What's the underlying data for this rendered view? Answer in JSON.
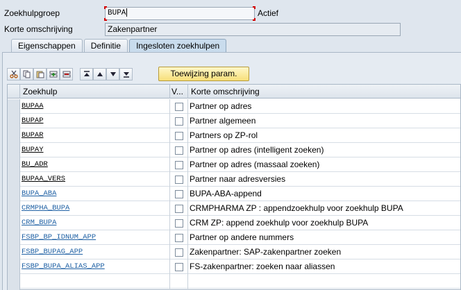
{
  "header": {
    "group_label": "Zoekhulpgroep",
    "group_value": "BUPA",
    "status": "Actief",
    "desc_label": "Korte omschrijving",
    "desc_value": "Zakenpartner"
  },
  "tabs": [
    {
      "label": "Eigenschappen",
      "active": false
    },
    {
      "label": "Definitie",
      "active": false
    },
    {
      "label": "Ingesloten zoekhulpen",
      "active": true
    }
  ],
  "toolbar": {
    "icons": [
      "cut-icon",
      "copy-icon",
      "paste-icon",
      "insert-row-icon",
      "delete-row-icon",
      "move-top-icon",
      "move-up-icon",
      "move-down-icon",
      "move-bottom-icon"
    ],
    "assign_label": "Toewijzing param."
  },
  "table": {
    "columns": [
      "Zoekhulp",
      "V...",
      "Korte omschrijving"
    ],
    "rows": [
      {
        "name": "BUPAA",
        "desc": "Partner op adres",
        "style": "dark",
        "checked": false
      },
      {
        "name": "BUPAP",
        "desc": "Partner algemeen",
        "style": "dark",
        "checked": false
      },
      {
        "name": "BUPAR",
        "desc": "Partners op ZP-rol",
        "style": "dark",
        "checked": false
      },
      {
        "name": "BUPAY",
        "desc": "Partner op adres (intelligent zoeken)",
        "style": "dark",
        "checked": false
      },
      {
        "name": "BU_ADR",
        "desc": "Partner op adres (massaal zoeken)",
        "style": "dark",
        "checked": false
      },
      {
        "name": "BUPAA_VERS",
        "desc": "Partner naar adresversies",
        "style": "dark",
        "checked": false
      },
      {
        "name": "BUPA_ABA",
        "desc": "BUPA-ABA-append",
        "style": "link",
        "checked": false
      },
      {
        "name": "CRMPHA_BUPA",
        "desc": "CRMPHARMA ZP :  appendzoekhulp voor zoekhulp BUPA",
        "style": "link",
        "checked": false
      },
      {
        "name": "CRM_BUPA",
        "desc": "CRM ZP: append zoekhulp voor zoekhulp BUPA",
        "style": "link",
        "checked": false
      },
      {
        "name": "FSBP_BP_IDNUM_APP",
        "desc": "Partner op andere nummers",
        "style": "link",
        "checked": false
      },
      {
        "name": "FSBP_BUPAG_APP",
        "desc": "Zakenpartner: SAP-zakenpartner zoeken",
        "style": "link",
        "checked": false
      },
      {
        "name": "FSBP_BUPA_ALIAS_APP",
        "desc": "FS-zakenpartner: zoeken naar aliassen",
        "style": "link",
        "checked": false
      }
    ]
  }
}
